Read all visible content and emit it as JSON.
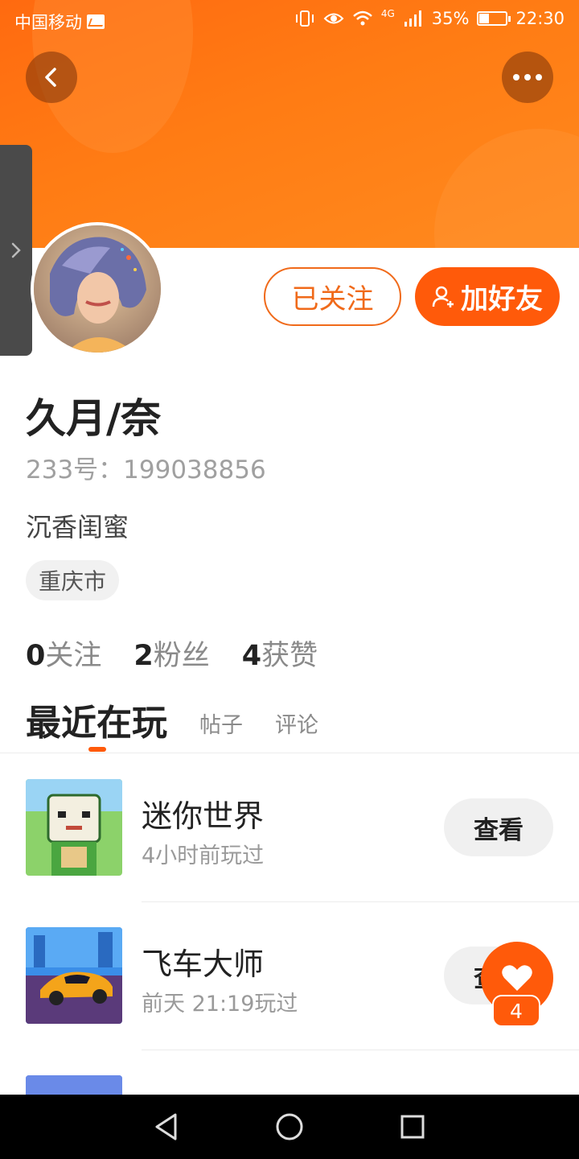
{
  "status_bar": {
    "carrier": "中国移动",
    "network": "4G",
    "battery": "35%",
    "battery_level": 0.35,
    "time": "22:30"
  },
  "colors": {
    "accent": "#ff5a0a",
    "banner": "#ff7c14"
  },
  "header": {
    "back_icon": "chevron-left-icon",
    "more_icon": "more-horizontal-icon"
  },
  "actions": {
    "followed_label": "已关注",
    "add_friend_label": "加好友",
    "add_friend_icon": "add-user-icon"
  },
  "profile": {
    "name": "久月/奈",
    "uid": "233号：199038856",
    "bio": "沉香闺蜜",
    "location": "重庆市"
  },
  "stats": [
    {
      "num": "0",
      "label": "关注"
    },
    {
      "num": "2",
      "label": "粉丝"
    },
    {
      "num": "4",
      "label": "获赞"
    }
  ],
  "tabs": {
    "active": "最近在玩",
    "posts": "帖子",
    "comments": "评论"
  },
  "games": [
    {
      "title": "迷你世界",
      "subtitle": "4小时前玩过",
      "button": "查看"
    },
    {
      "title": "飞车大师",
      "subtitle": "前天 21:19玩过",
      "button": "查看"
    }
  ],
  "like": {
    "icon": "heart-icon",
    "count": "4"
  }
}
